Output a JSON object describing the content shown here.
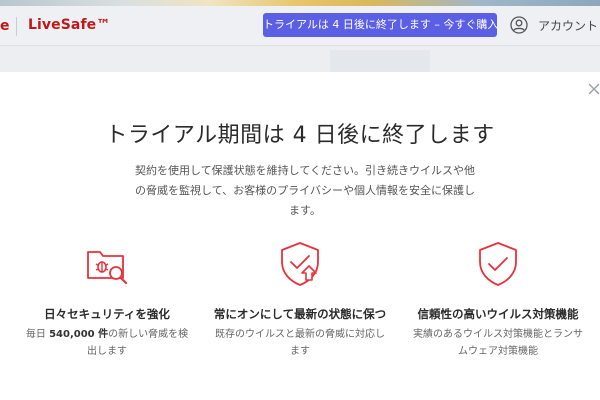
{
  "header": {
    "brand_mark": "e",
    "brand_name": "LiveSafe™",
    "trial_banner": "トライアルは 4 日後に終了します – 今すぐ購入",
    "account_label": "アカウント"
  },
  "modal": {
    "title": "トライアル期間は 4 日後に終了します",
    "description": "契約を使用して保護状態を維持してください。引き続きウイルスや他の脅威を監視して、お客様のプライバシーや個人情報を安全に保護します。",
    "features": [
      {
        "icon": "folder-bug-search-icon",
        "title": "日々セキュリティを強化",
        "desc_prefix": "毎日 ",
        "desc_strong": "540,000 件",
        "desc_suffix": "の新しい脅威を検出します"
      },
      {
        "icon": "shield-upload-icon",
        "title": "常にオンにして最新の状態に保つ",
        "desc": "既存のウイルスと最新の脅威に対応します"
      },
      {
        "icon": "shield-check-icon",
        "title": "信頼性の高いウイルス対策機能",
        "desc": "実績のあるウイルス対策機能とランサムウェア対策機能"
      }
    ]
  },
  "colors": {
    "brand_red": "#c01818",
    "icon_red": "#e8323c",
    "banner_blue": "#5b5fe3"
  }
}
